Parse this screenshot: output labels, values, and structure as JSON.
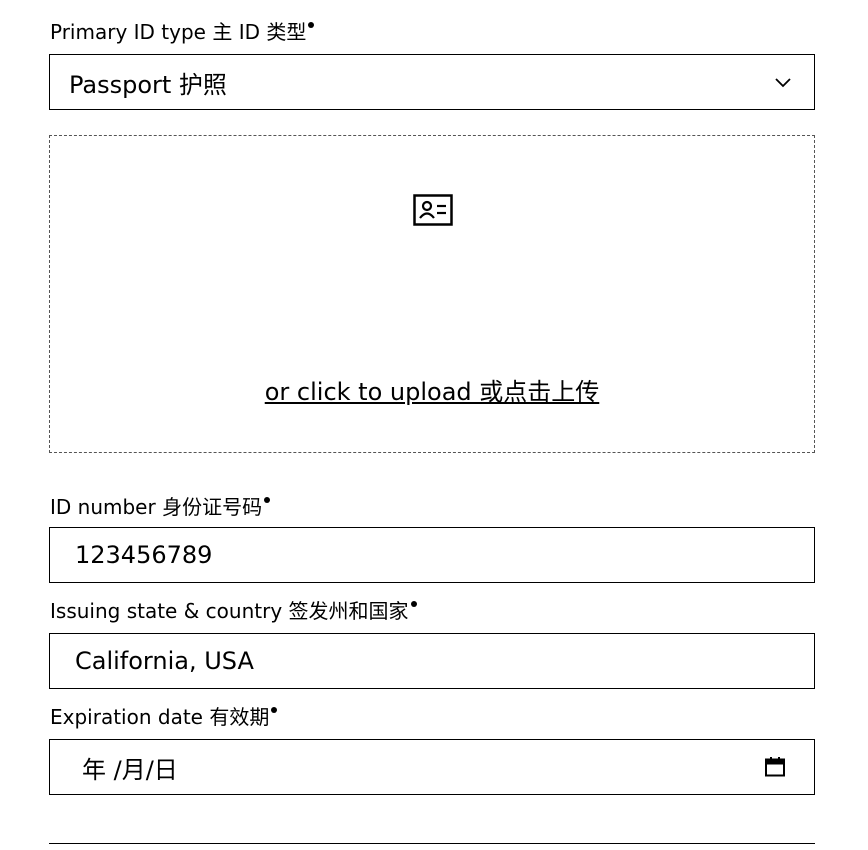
{
  "primary_id": {
    "label": "Primary ID type 主 ID 类型",
    "selected": "Passport 护照",
    "chevron_icon": "chevron-down-icon"
  },
  "upload": {
    "icon": "id-card-icon",
    "link_text": "or click to upload 或点击上传"
  },
  "id_number": {
    "label": "ID number 身份证号码",
    "value": "123456789"
  },
  "issuing": {
    "label": "Issuing state & country 签发州和国家",
    "value": "California, USA"
  },
  "expiration": {
    "label": "Expiration date 有效期",
    "placeholder": "年 /月/日",
    "calendar_icon": "calendar-icon"
  }
}
